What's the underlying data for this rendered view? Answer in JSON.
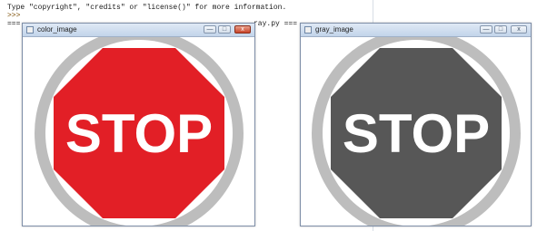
{
  "console": {
    "line1": "Type \"copyright\", \"credits\" or \"license()\" for more information.",
    "line2": ">>>",
    "line3_prefix": "===",
    "line3_suffix": "ray.py ==="
  },
  "windows": [
    {
      "title": "color_image",
      "sign_text": "STOP",
      "sign_fill": "#e21f26",
      "ring_color": "#bdbdbd",
      "text_color": "#ffffff"
    },
    {
      "title": "gray_image",
      "sign_text": "STOP",
      "sign_fill": "#575757",
      "ring_color": "#bdbdbd",
      "text_color": "#ffffff"
    }
  ],
  "controls": {
    "minimize": "—",
    "maximize": "□",
    "close": "x"
  }
}
